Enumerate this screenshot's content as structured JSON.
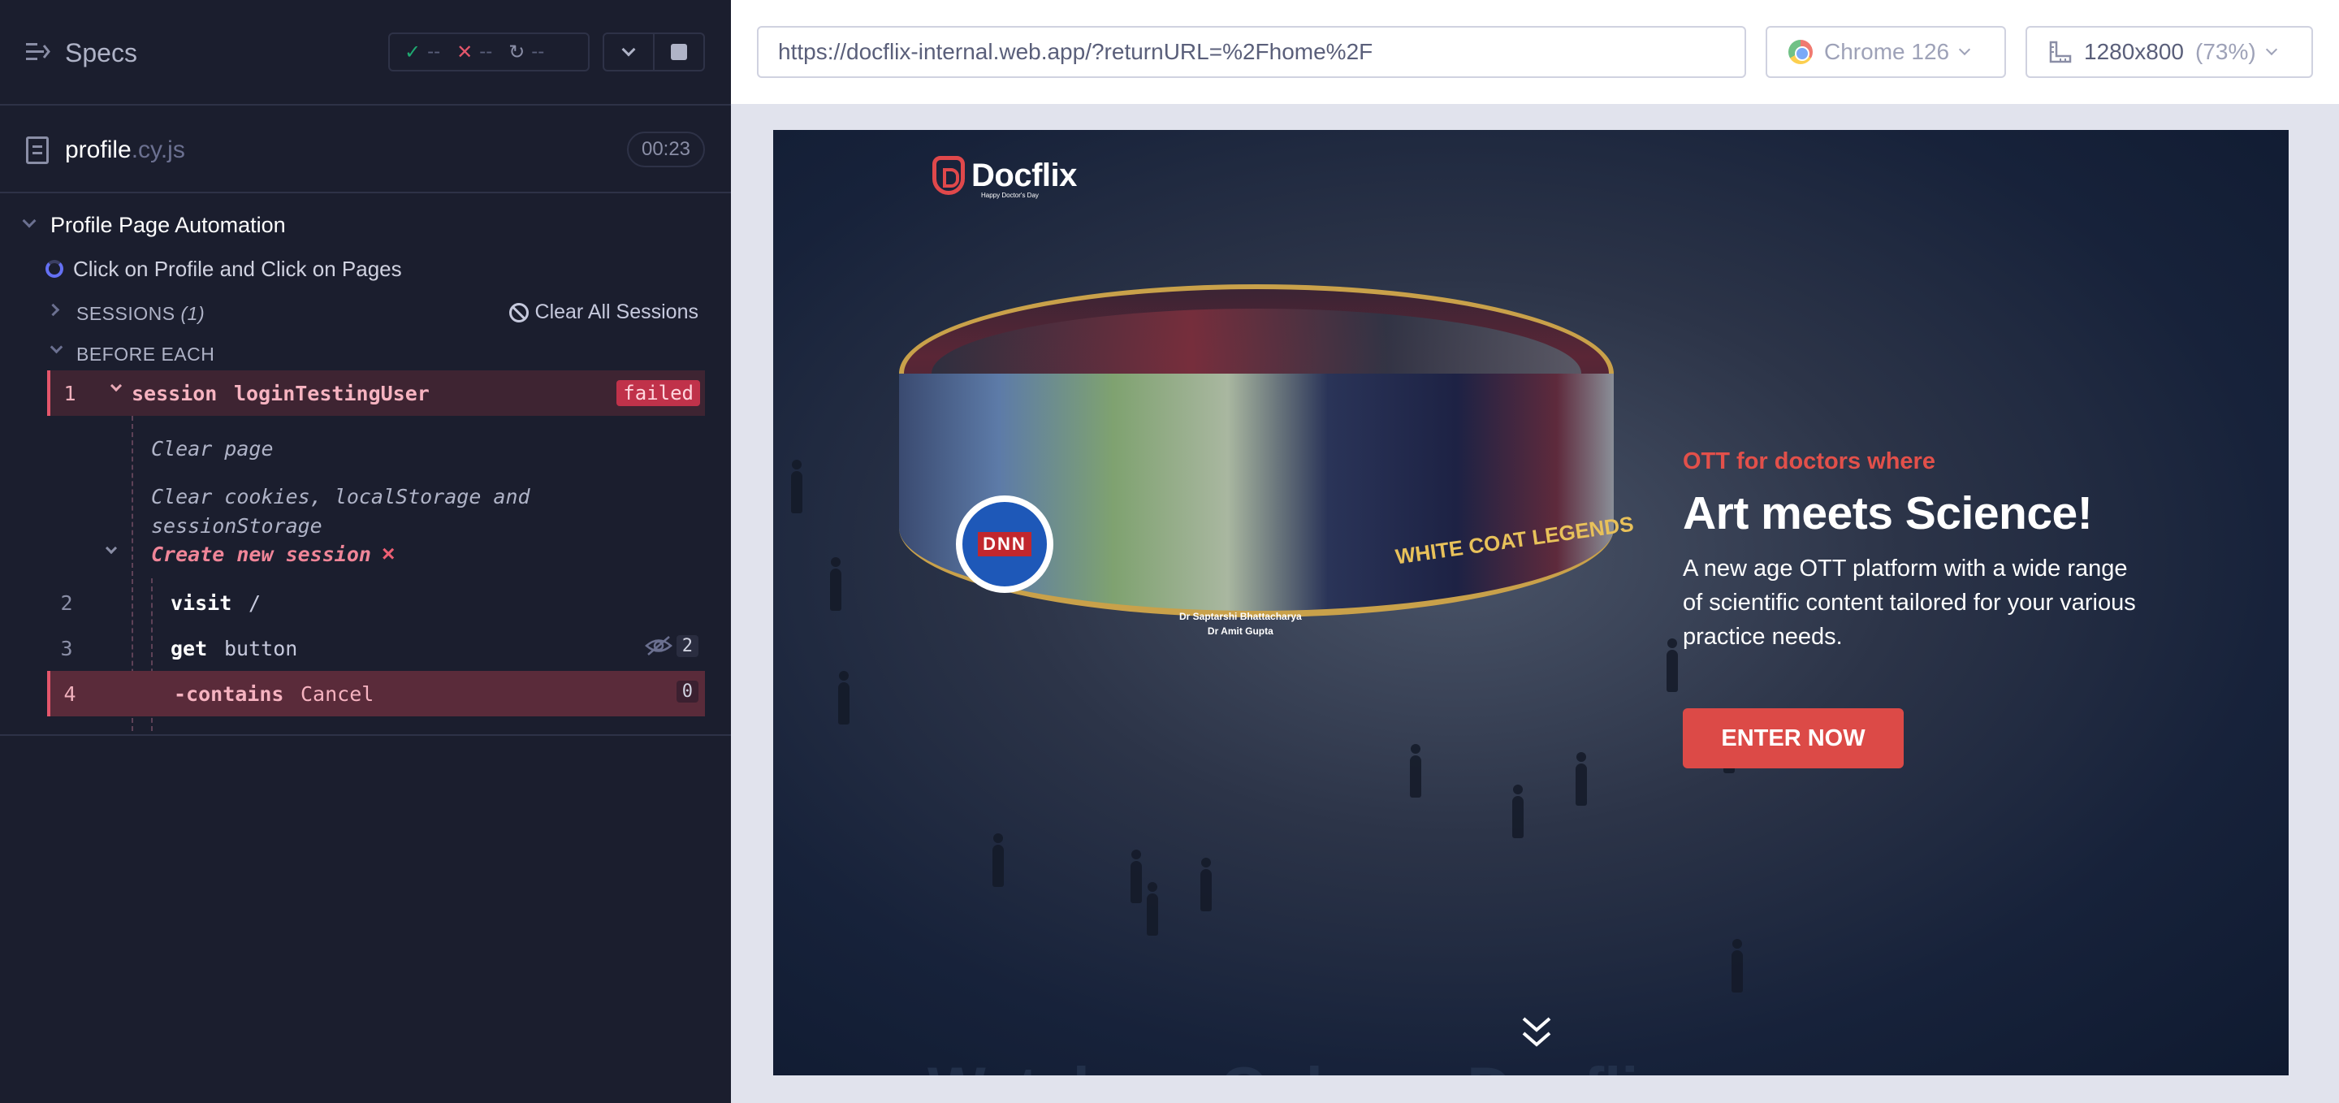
{
  "runner": {
    "header": {
      "title": "Specs",
      "stats": {
        "passed": "--",
        "failed": "--",
        "pending": "--"
      }
    },
    "spec_file": {
      "name": "profile",
      "ext": ".cy.js",
      "duration": "00:23"
    },
    "suite": {
      "title": "Profile Page Automation",
      "test_title": "Click on Profile and Click on Pages",
      "sessions_label": "SESSIONS",
      "sessions_count": "(1)",
      "clear_sessions_label": "Clear All Sessions",
      "before_each_label": "BEFORE EACH",
      "commands": [
        {
          "num": "1",
          "name": "session",
          "message": "loginTestingUser",
          "status": "failed"
        },
        {
          "num": "2",
          "name": "visit",
          "message": "/"
        },
        {
          "num": "3",
          "name": "get",
          "message": "button",
          "count": "2"
        },
        {
          "num": "4",
          "name": "-contains",
          "message": "Cancel",
          "count": "0"
        }
      ],
      "session_logs": {
        "clear_page": "Clear page",
        "clear_cookies": "Clear cookies, localStorage and sessionStorage",
        "create_session": "Create new session"
      }
    }
  },
  "aut": {
    "url": "https://docflix-internal.web.app/?returnURL=%2Fhome%2F",
    "browser": "Chrome 126",
    "viewport": "1280x800",
    "scale": "(73%)"
  },
  "app": {
    "logo_text": "Docflix",
    "logo_tagline": "Happy Doctor's Day",
    "hero_kicker": "OTT for doctors where",
    "hero_title": "Art meets Science!",
    "hero_description": "A new age OTT platform with a wide range of scientific content tailored for your various practice needs.",
    "cta_label": "ENTER NOW",
    "badge_text": "DNN",
    "show_title": "WHITE COAT LEGENDS",
    "caption_line1": "Dr Saptarshi Bhattacharya",
    "caption_line2": "Dr Amit Gupta",
    "next_heading": "Watch on Only on Docflix"
  },
  "colors": {
    "runner_bg": "#1b1e2e",
    "failed_accent": "#e4566b",
    "brand_red": "#dc4a47",
    "hero_kicker": "#e2504a"
  }
}
